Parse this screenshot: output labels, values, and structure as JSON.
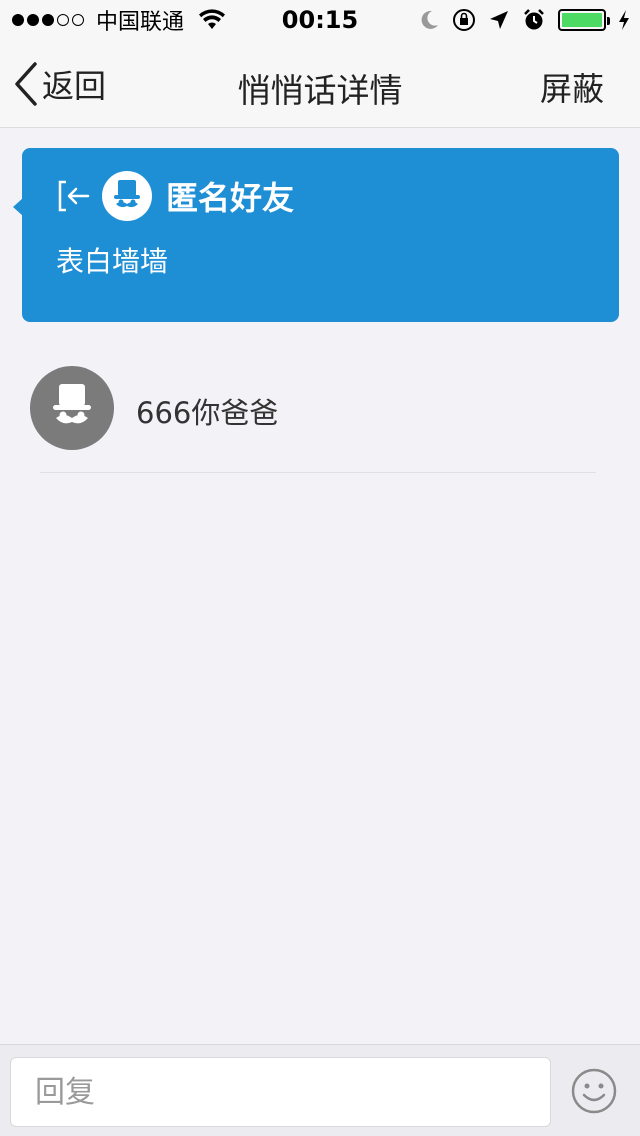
{
  "status_bar": {
    "carrier": "中国联通",
    "time": "00:15",
    "battery_level": 1.0
  },
  "nav": {
    "back_label": "返回",
    "title": "悄悄话详情",
    "block_label": "屏蔽"
  },
  "post": {
    "author": "匿名好友",
    "content": "表白墙墙",
    "card_color": "#1e8fd4"
  },
  "replies": [
    {
      "text": "666你爸爸"
    }
  ],
  "input": {
    "placeholder": "回复",
    "value": ""
  }
}
